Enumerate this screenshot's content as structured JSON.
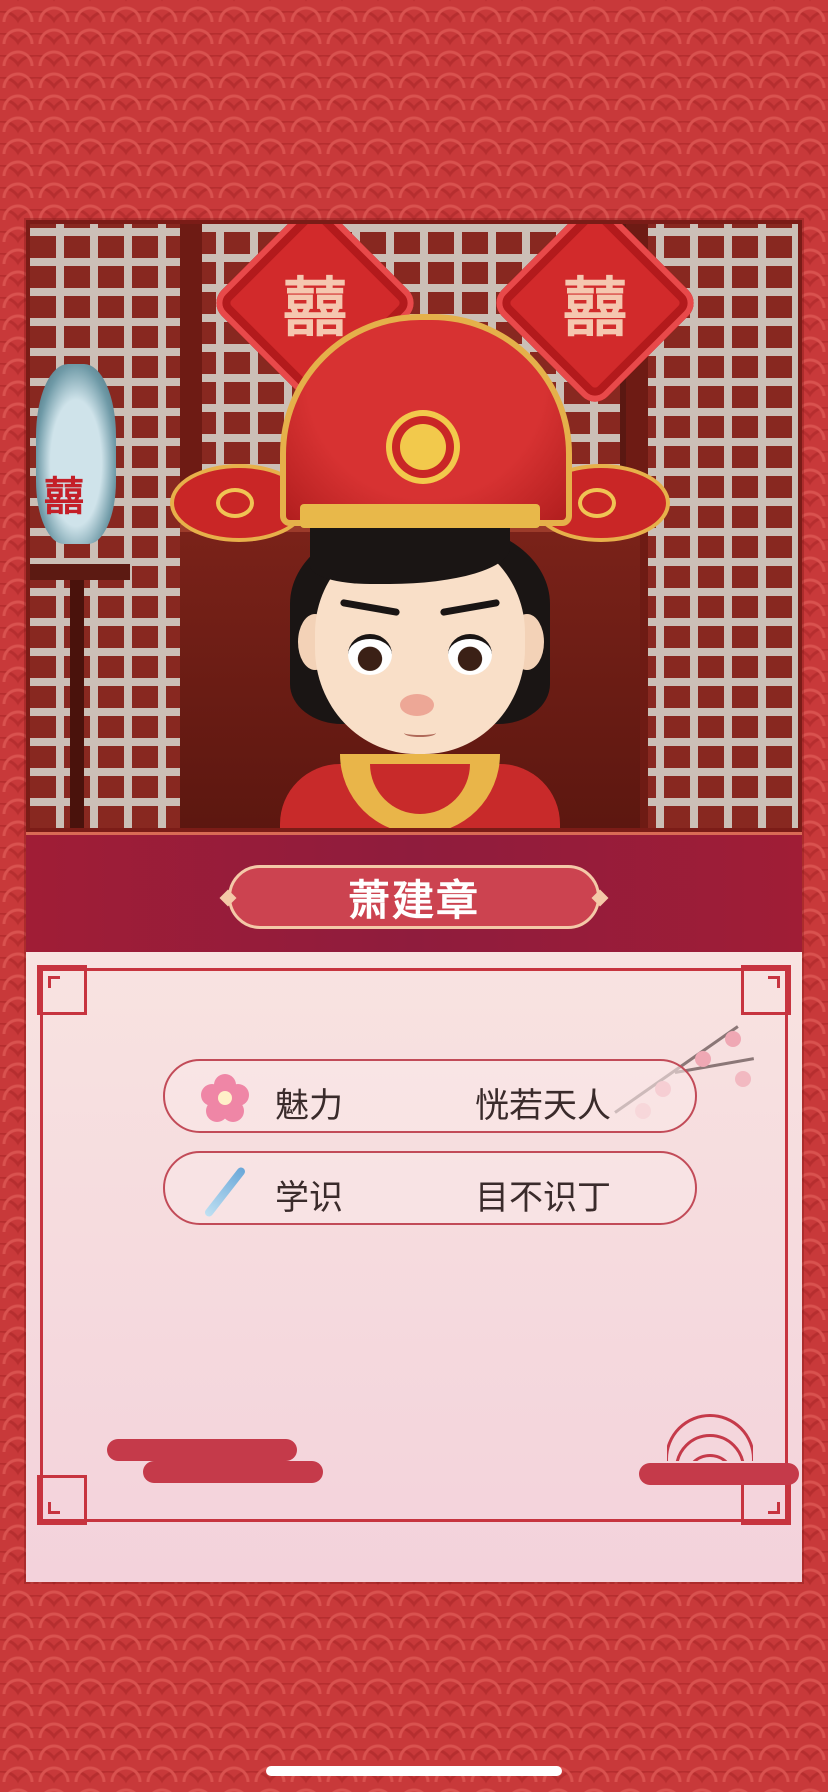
{
  "character": {
    "name": "萧建章",
    "scene_decor": {
      "paper_cut_char": "囍",
      "vase_char": "囍"
    }
  },
  "attributes": [
    {
      "icon": "plum-blossom-icon",
      "label": "魅力",
      "value": "恍若天人"
    },
    {
      "icon": "brush-pen-icon",
      "label": "学识",
      "value": "目不识丁"
    }
  ],
  "colors": {
    "background": "#c8393a",
    "banner": "#8f1c3d",
    "name_plate": "#cc4350",
    "panel": "#f3d2db",
    "frame": "#c7343f"
  }
}
